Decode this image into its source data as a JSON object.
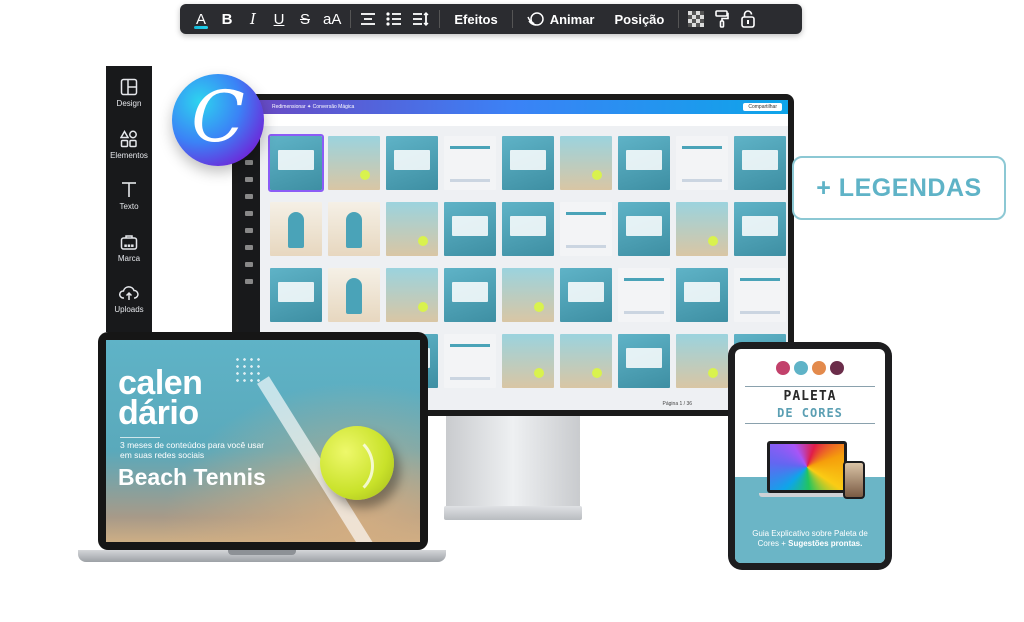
{
  "toolbar": {
    "text_color": "A",
    "bold": "B",
    "italic": "I",
    "underline": "U",
    "strikethrough": "S",
    "case": "aA",
    "effects": "Efeitos",
    "animate": "Animar",
    "position": "Posição"
  },
  "sidebar": {
    "items": [
      {
        "label": "Design",
        "icon": "layout-icon"
      },
      {
        "label": "Elementos",
        "icon": "shapes-icon"
      },
      {
        "label": "Texto",
        "icon": "text-icon"
      },
      {
        "label": "Marca",
        "icon": "brand-kit-icon"
      },
      {
        "label": "Uploads",
        "icon": "upload-cloud-icon"
      }
    ]
  },
  "logo": {
    "letter": "C"
  },
  "monitor": {
    "breadcrumb": "Redimensionar ✦ Conversão Mágica",
    "share": "Compartilhar",
    "pager": "Página 1 / 36"
  },
  "badge": {
    "text": "+ LEGENDAS"
  },
  "laptop": {
    "title_line1": "calen",
    "title_line2": "dário",
    "subtitle": "3 meses de conteúdos para você usar em suas redes sociais",
    "headline": "Beach Tennis"
  },
  "tablet": {
    "swatches": [
      "#c2416b",
      "#5fb3c7",
      "#e38a4c",
      "#6b2d4a"
    ],
    "title1": "PALETA",
    "title2": "DE CORES",
    "caption_normal": "Guia Explicativo sobre Paleta de Cores + ",
    "caption_bold": "Sugestões prontas."
  },
  "colors": {
    "accent_teal": "#5fb3c7",
    "toolbar_bg": "#2b2c30",
    "sidebar_bg": "#18191b"
  }
}
